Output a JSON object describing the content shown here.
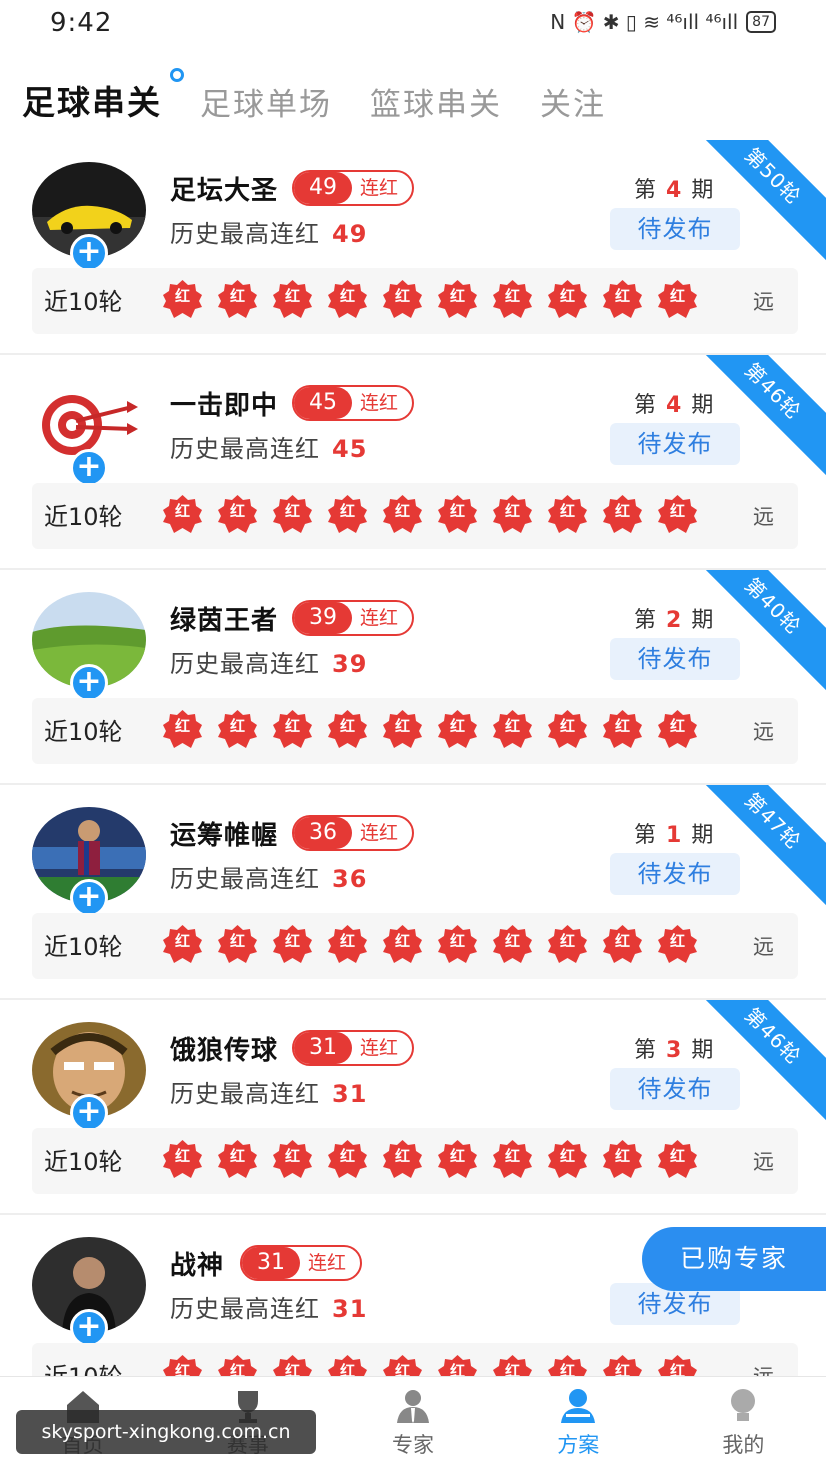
{
  "status_bar": {
    "time": "9:42",
    "icons": "N ⏰ ✱ ▯ ≋ ⁴⁶ıll ⁴⁶ıll",
    "battery": "87"
  },
  "tabs": [
    {
      "label": "足球串关",
      "active": true
    },
    {
      "label": "足球单场",
      "active": false
    },
    {
      "label": "篮球串关",
      "active": false
    },
    {
      "label": "关注",
      "active": false
    }
  ],
  "common": {
    "streak_label": "连红",
    "history_label": "历史最高连红",
    "period_prefix": "第",
    "period_suffix": "期",
    "pending_label": "待发布",
    "rounds_label": "近10轮",
    "rounds_more": "远",
    "mark_text": "红",
    "plus": "+"
  },
  "experts": [
    {
      "name": "足坛大圣",
      "streak": "49",
      "history_max": "49",
      "period": "4",
      "ribbon": "第50轮",
      "avatar": "car-avatar"
    },
    {
      "name": "一击即中",
      "streak": "45",
      "history_max": "45",
      "period": "4",
      "ribbon": "第46轮",
      "avatar": "target-avatar"
    },
    {
      "name": "绿茵王者",
      "streak": "39",
      "history_max": "39",
      "period": "2",
      "ribbon": "第40轮",
      "avatar": "field-avatar"
    },
    {
      "name": "运筹帷幄",
      "streak": "36",
      "history_max": "36",
      "period": "1",
      "ribbon": "第47轮",
      "avatar": "player-avatar"
    },
    {
      "name": "饿狼传球",
      "streak": "31",
      "history_max": "31",
      "period": "3",
      "ribbon": "第46轮",
      "avatar": "cartoon-avatar"
    },
    {
      "name": "战神",
      "streak": "31",
      "history_max": "31",
      "period": "",
      "ribbon": "",
      "avatar": "man-avatar"
    }
  ],
  "fab_label": "已购专家",
  "bottom_nav": [
    {
      "label": "首页",
      "icon": "home-icon",
      "active": false
    },
    {
      "label": "赛事",
      "icon": "trophy-icon",
      "active": false
    },
    {
      "label": "专家",
      "icon": "expert-icon",
      "active": false
    },
    {
      "label": "方案",
      "icon": "plan-icon",
      "active": true
    },
    {
      "label": "我的",
      "icon": "profile-icon",
      "active": false
    }
  ],
  "watermark": "skysport-xingkong.com.cn",
  "colors": {
    "accent_blue": "#2196f3",
    "streak_red": "#e53935",
    "pending_bg": "#e8f1fc"
  }
}
